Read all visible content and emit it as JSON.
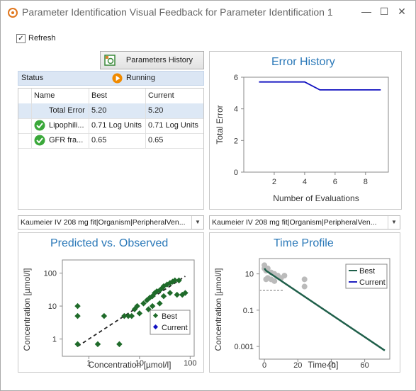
{
  "window": {
    "title": "Parameter Identification Visual Feedback for Parameter Identification 1",
    "controls": {
      "minimize": "—",
      "maximize": "☐",
      "close": "✕"
    }
  },
  "refresh": {
    "label": "Refresh",
    "checked": true
  },
  "parameters_history_button": {
    "label": "Parameters History"
  },
  "status": {
    "label": "Status",
    "value": "Running"
  },
  "grid": {
    "columns": [
      "Name",
      "Best",
      "Current"
    ],
    "rows": [
      {
        "name": "Total Error",
        "best": "5.20",
        "current": "5.20",
        "icon": ""
      },
      {
        "name": "Lipophili...",
        "best": "0.71 Log Units",
        "current": "0.71 Log Units",
        "icon": "check-circle-icon"
      },
      {
        "name": "GFR fra...",
        "best": "0.65",
        "current": "0.65",
        "icon": "check-circle-icon"
      }
    ]
  },
  "combos": {
    "left": "Kaumeier IV 208 mg fit|Organism|PeripheralVen...",
    "right": "Kaumeier IV 208 mg fit|Organism|PeripheralVen..."
  },
  "charts": {
    "error_history": {
      "title": "Error History",
      "xlabel": "Number of Evaluations",
      "ylabel": "Total Error",
      "xticks": [
        "2",
        "4",
        "6",
        "8"
      ],
      "yticks": [
        "0",
        "2",
        "4",
        "6"
      ]
    },
    "pred_vs_obs": {
      "title": "Predicted vs. Observed",
      "xlabel": "Concentration [µmol/l]",
      "ylabel": "Concentration [µmol/l]",
      "xticks": [
        "1",
        "10",
        "100"
      ],
      "yticks": [
        "1",
        "10",
        "100"
      ],
      "legend": [
        "Best",
        "Current"
      ]
    },
    "time_profile": {
      "title": "Time Profile",
      "xlabel": "Time [h]",
      "ylabel": "Concentration [µmol/l]",
      "xticks": [
        "0",
        "20",
        "40",
        "60"
      ],
      "yticks": [
        "10",
        "0.1",
        "0.001"
      ],
      "legend": [
        "Best",
        "Current"
      ]
    }
  },
  "chart_data": [
    {
      "type": "line",
      "title": "Error History",
      "xlabel": "Number of Evaluations",
      "ylabel": "Total Error",
      "xlim": [
        0,
        9.5
      ],
      "ylim": [
        0,
        6
      ],
      "series": [
        {
          "name": "",
          "x": [
            1,
            2,
            3,
            4,
            5,
            6,
            7,
            8,
            9
          ],
          "y": [
            5.7,
            5.7,
            5.7,
            5.7,
            5.2,
            5.2,
            5.2,
            5.2,
            5.2
          ]
        }
      ]
    },
    {
      "type": "scatter",
      "title": "Predicted vs. Observed",
      "xlabel": "Concentration [µmol/l]",
      "ylabel": "Concentration [µmol/l]",
      "xscale": "log",
      "yscale": "log",
      "xlim": [
        0.3,
        120
      ],
      "ylim": [
        0.3,
        250
      ],
      "series": [
        {
          "name": "Best",
          "color": "#1f6b2a",
          "points": [
            [
              0.6,
              10
            ],
            [
              0.6,
              5
            ],
            [
              0.6,
              0.7
            ],
            [
              1.5,
              0.7
            ],
            [
              2,
              5
            ],
            [
              4,
              0.7
            ],
            [
              5,
              5
            ],
            [
              6,
              5
            ],
            [
              7,
              5
            ],
            [
              8,
              8
            ],
            [
              9,
              10
            ],
            [
              10,
              6
            ],
            [
              12,
              12
            ],
            [
              14,
              15
            ],
            [
              16,
              18
            ],
            [
              18,
              20
            ],
            [
              20,
              25
            ],
            [
              22,
              28
            ],
            [
              25,
              30
            ],
            [
              28,
              35
            ],
            [
              30,
              40
            ],
            [
              35,
              45
            ],
            [
              40,
              50
            ],
            [
              45,
              55
            ],
            [
              50,
              60
            ],
            [
              60,
              60
            ],
            [
              30,
              20
            ],
            [
              40,
              25
            ],
            [
              55,
              22
            ],
            [
              70,
              22
            ],
            [
              80,
              25
            ],
            [
              25,
              12
            ],
            [
              18,
              10
            ],
            [
              15,
              8
            ]
          ]
        },
        {
          "name": "Current",
          "color": "#1010c0",
          "points": []
        }
      ],
      "reference_line": {
        "x": [
          0.6,
          80
        ],
        "y": [
          0.6,
          80
        ],
        "style": "dashed"
      }
    },
    {
      "type": "line",
      "title": "Time Profile",
      "xlabel": "Time [h]",
      "ylabel": "Concentration [µmol/l]",
      "yscale": "log",
      "xlim": [
        -3,
        75
      ],
      "ylim": [
        0.0002,
        70
      ],
      "series": [
        {
          "name": "Best",
          "color": "#1f5f4a",
          "x": [
            0,
            1,
            72
          ],
          "y": [
            20,
            15,
            0.0006
          ]
        },
        {
          "name": "Current",
          "color": "#2020c0",
          "x": [
            0,
            1,
            72
          ],
          "y": [
            20,
            15,
            0.0006
          ]
        }
      ],
      "observed": {
        "color": "#bbbbbb",
        "points": [
          [
            0,
            30
          ],
          [
            0,
            20
          ],
          [
            1,
            15
          ],
          [
            2,
            20
          ],
          [
            4,
            12
          ],
          [
            6,
            10
          ],
          [
            8,
            8
          ],
          [
            10,
            6
          ],
          [
            12,
            8
          ],
          [
            24,
            5
          ],
          [
            24,
            2
          ],
          [
            1,
            5
          ],
          [
            2,
            6
          ],
          [
            4,
            5
          ],
          [
            6,
            4
          ]
        ]
      }
    }
  ]
}
